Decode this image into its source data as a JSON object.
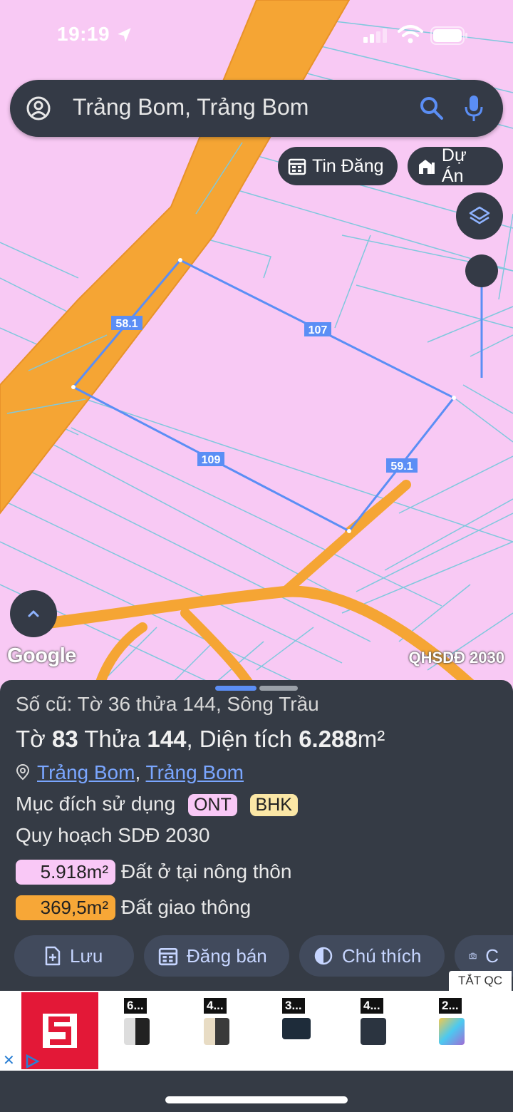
{
  "status": {
    "time": "19:19"
  },
  "search": {
    "text": "Trảng Bom, Trảng Bom"
  },
  "chips": {
    "listings": "Tin Đăng",
    "projects": "Dự Án"
  },
  "map": {
    "edge_labels": [
      "58.1",
      "107",
      "109",
      "59.1"
    ],
    "google_label": "Google",
    "plan_label": "QHSDĐ 2030"
  },
  "parcel": {
    "old_info": "Số cũ: Tờ 36 thửa 144, Sông Trầu",
    "title_prefix": "Tờ ",
    "sheet": "83",
    "title_mid": " Thửa ",
    "plot": "144",
    "title_area_label": ", Diện tích ",
    "area": "6.288",
    "area_unit": "m²",
    "location_1": "Trảng Bom",
    "location_sep": ", ",
    "location_2": "Trảng Bom",
    "purpose_label": "Mục đích sử dụng",
    "purpose_tags": [
      "ONT",
      "BHK"
    ],
    "plan_title": "Quy hoạch SDĐ 2030",
    "plan_rows": [
      {
        "area": "5.918m²",
        "label": "Đất ở tại nông thôn",
        "color": "#f9c8f6"
      },
      {
        "area": "369,5m²",
        "label": "Đất giao thông",
        "color": "#f7a737"
      }
    ]
  },
  "actions": [
    "Lưu",
    "Đăng bán",
    "Chú thích",
    "C"
  ],
  "ad": {
    "toggle_label": "TẮT QC",
    "products": [
      "6...",
      "4...",
      "3...",
      "4...",
      "2..."
    ]
  },
  "colors": {
    "accent": "#5b8ef5",
    "road": "#f5a534",
    "land": "#f8c9f4",
    "sheet": "#353b45"
  }
}
